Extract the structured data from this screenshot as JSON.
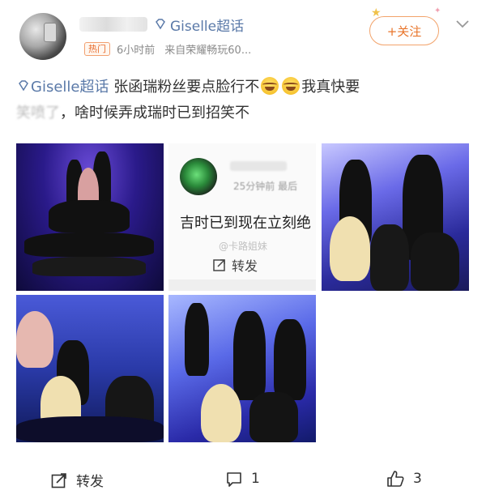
{
  "header": {
    "topic_name": "Giselle超话",
    "hot_badge": "热门",
    "time": "6小时前",
    "source": "来自荣耀畅玩60...",
    "follow_label": "+关注",
    "icons": [
      "diamond-icon",
      "star-icon",
      "chevron-down-icon"
    ]
  },
  "post": {
    "topic_link": "Giselle超话",
    "line1": "张函瑞粉丝要点脸行不",
    "line1_tail": "我真快要",
    "blurred": "笑喷了",
    "line2": "，啥时候弄成瑞时已到招笑不",
    "emoji": "laugh-cry-emoji"
  },
  "images": {
    "screenshot_text": "吉时已到现在立刻绝",
    "screenshot_repost": "转发",
    "screenshot_watermark": "@卡路姐妹",
    "screenshot_meta": "25分钟前 最后"
  },
  "footer": {
    "repost_label": "转发",
    "comment_count": "1",
    "like_count": "3"
  },
  "colors": {
    "topic": "#5a79a8",
    "follow": "#e8742a",
    "hot": "#e86b2b"
  }
}
